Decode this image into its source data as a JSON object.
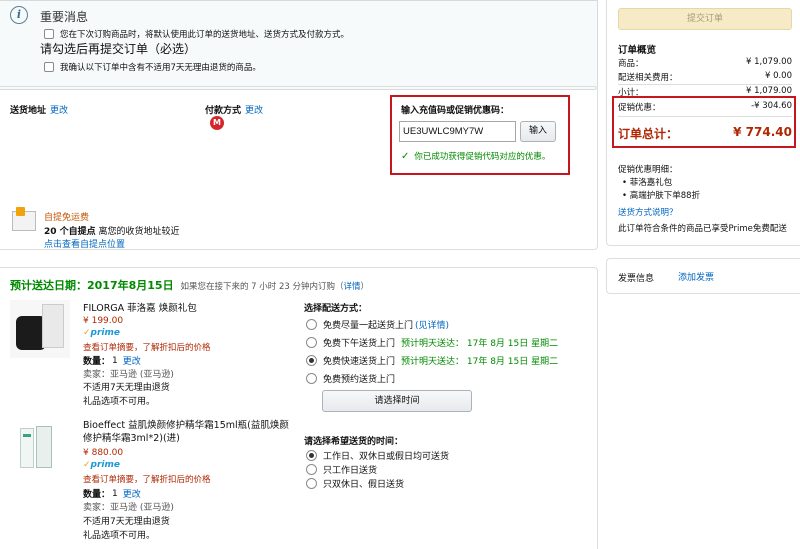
{
  "notice": {
    "title": "重要消息",
    "check1": "您在下次订购商品时，将默认使用此订单的送货地址、送货方式及付款方式。",
    "required": "请勾选后再提交订单（必选）",
    "check2": "我确认以下订单中含有不适用7天无理由退货的商品。"
  },
  "shipping": {
    "label": "送货地址",
    "change": "更改"
  },
  "payment": {
    "label": "付款方式",
    "change": "更改"
  },
  "coupon": {
    "title": "输入充值码或促销优惠码：",
    "value": "UE3UWLC9MY7W",
    "apply": "输入",
    "success": "你已成功获得促销代码对应的优惠。"
  },
  "pickup": {
    "free": "自提免运费",
    "count_bold": "20 个自提点",
    "count_rest": " 离您的收货地址较近",
    "link": "点击查看自提点位置"
  },
  "delivery": {
    "label": "预计送达日期：",
    "date": "2017年8月15日",
    "note": "如果您在接下来的 7 小时 23 分钟内订购（",
    "details": "详情",
    "note_end": "）"
  },
  "items": [
    {
      "title": "FILORGA 菲洛嘉 焕颜礼包",
      "price": "¥ 199.00",
      "prime": "prime",
      "summary": "查看订单摘要，了解折扣后的价格",
      "qty_label": "数量：",
      "qty": "1",
      "change": "更改",
      "seller": "卖家：亚马逊 (亚马逊)",
      "no_return": "不适用7天无理由退货",
      "no_gift": "礼品选项不可用。"
    },
    {
      "title": "Bioeffect 益肌焕颜修护精华霜15ml瓶(益肌焕颜修护精华霜3ml*2)(进)",
      "price": "¥ 880.00",
      "prime": "prime",
      "summary": "查看订单摘要，了解折扣后的价格",
      "qty_label": "数量：",
      "qty": "1",
      "change": "更改",
      "seller": "卖家：亚马逊 (亚马逊)",
      "no_return": "不适用7天无理由退货",
      "no_gift": "礼品选项不可用。"
    }
  ],
  "ship_options": {
    "title": "选择配送方式：",
    "opt1": "免费尽量一起送货上门",
    "opt1_link": "(见详情)",
    "opt2": "免费下午送货上门",
    "opt2_eta": "预计明天送达：  17年 8月 15日 星期二",
    "opt3": "免费快速送货上门",
    "opt3_eta": "预计明天送达：  17年 8月 15日 星期二",
    "opt4": "免费预约送货上门",
    "time_button": "请选择时间"
  },
  "time_options": {
    "title": "请选择希望送货的时间：",
    "opt1": "工作日、双休日或假日均可送货",
    "opt2": "只工作日送货",
    "opt3": "只双休日、假日送货"
  },
  "summary": {
    "submit": "提交订单",
    "title": "订单概览",
    "goods_label": "商品：",
    "goods": "¥ 1,079.00",
    "shipping_label": "配送相关费用：",
    "shipping": "¥ 0.00",
    "subtotal_label": "小计：",
    "subtotal": "¥ 1,079.00",
    "promo_label": "促销优惠：",
    "promo": "-¥ 304.60",
    "total_label": "订单总计：",
    "total": "¥ 774.40",
    "promo_desc_title": "促销优惠明细：",
    "promo_desc1": "菲洛嘉礼包",
    "promo_desc2": "高端护肤下单88折",
    "shipping_link": "送货方式说明？",
    "prime_note": "此订单符合条件的商品已享受Prime免费配送",
    "invoice_label": "发票信息",
    "invoice_add": "添加发票"
  },
  "colors": {
    "highlight": "#c7161d",
    "price": "#b12704",
    "success": "#008a00",
    "link": "#0066c0"
  }
}
